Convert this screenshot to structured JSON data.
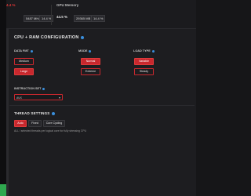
{
  "topbar": {
    "cpu_percent": "4.4 %",
    "cpu_chip_a": "5487 MHz",
    "cpu_chip_b": "14.4 %",
    "gpu_memory_label": "GPU Memory",
    "gpu_percent": "44.5 %",
    "gpu_chip_a": "29365 MB",
    "gpu_chip_b": "14.4 %"
  },
  "config": {
    "title": "CPU + RAM CONFIGURATION",
    "data_fmt": {
      "label": "DATA FMT",
      "options": [
        "Medium",
        "Large"
      ]
    },
    "mode": {
      "label": "MODE",
      "options": [
        "Normal",
        "Extreme"
      ]
    },
    "load_type": {
      "label": "LOAD TYPE",
      "options": [
        "Variable",
        "Steady"
      ]
    },
    "instruction_set": {
      "label": "INSTRUCTION SET",
      "value": "AVX"
    }
  },
  "threads": {
    "title": "THREAD SETTINGS",
    "options": [
      "Auto",
      "Fixed",
      "Core Cycling"
    ],
    "note": "ALL / selected threads per logical core for fully stressing CPU"
  },
  "colors": {
    "accent": "#c8282e",
    "help": "#3a8fdc",
    "status": "#2fa84f"
  }
}
